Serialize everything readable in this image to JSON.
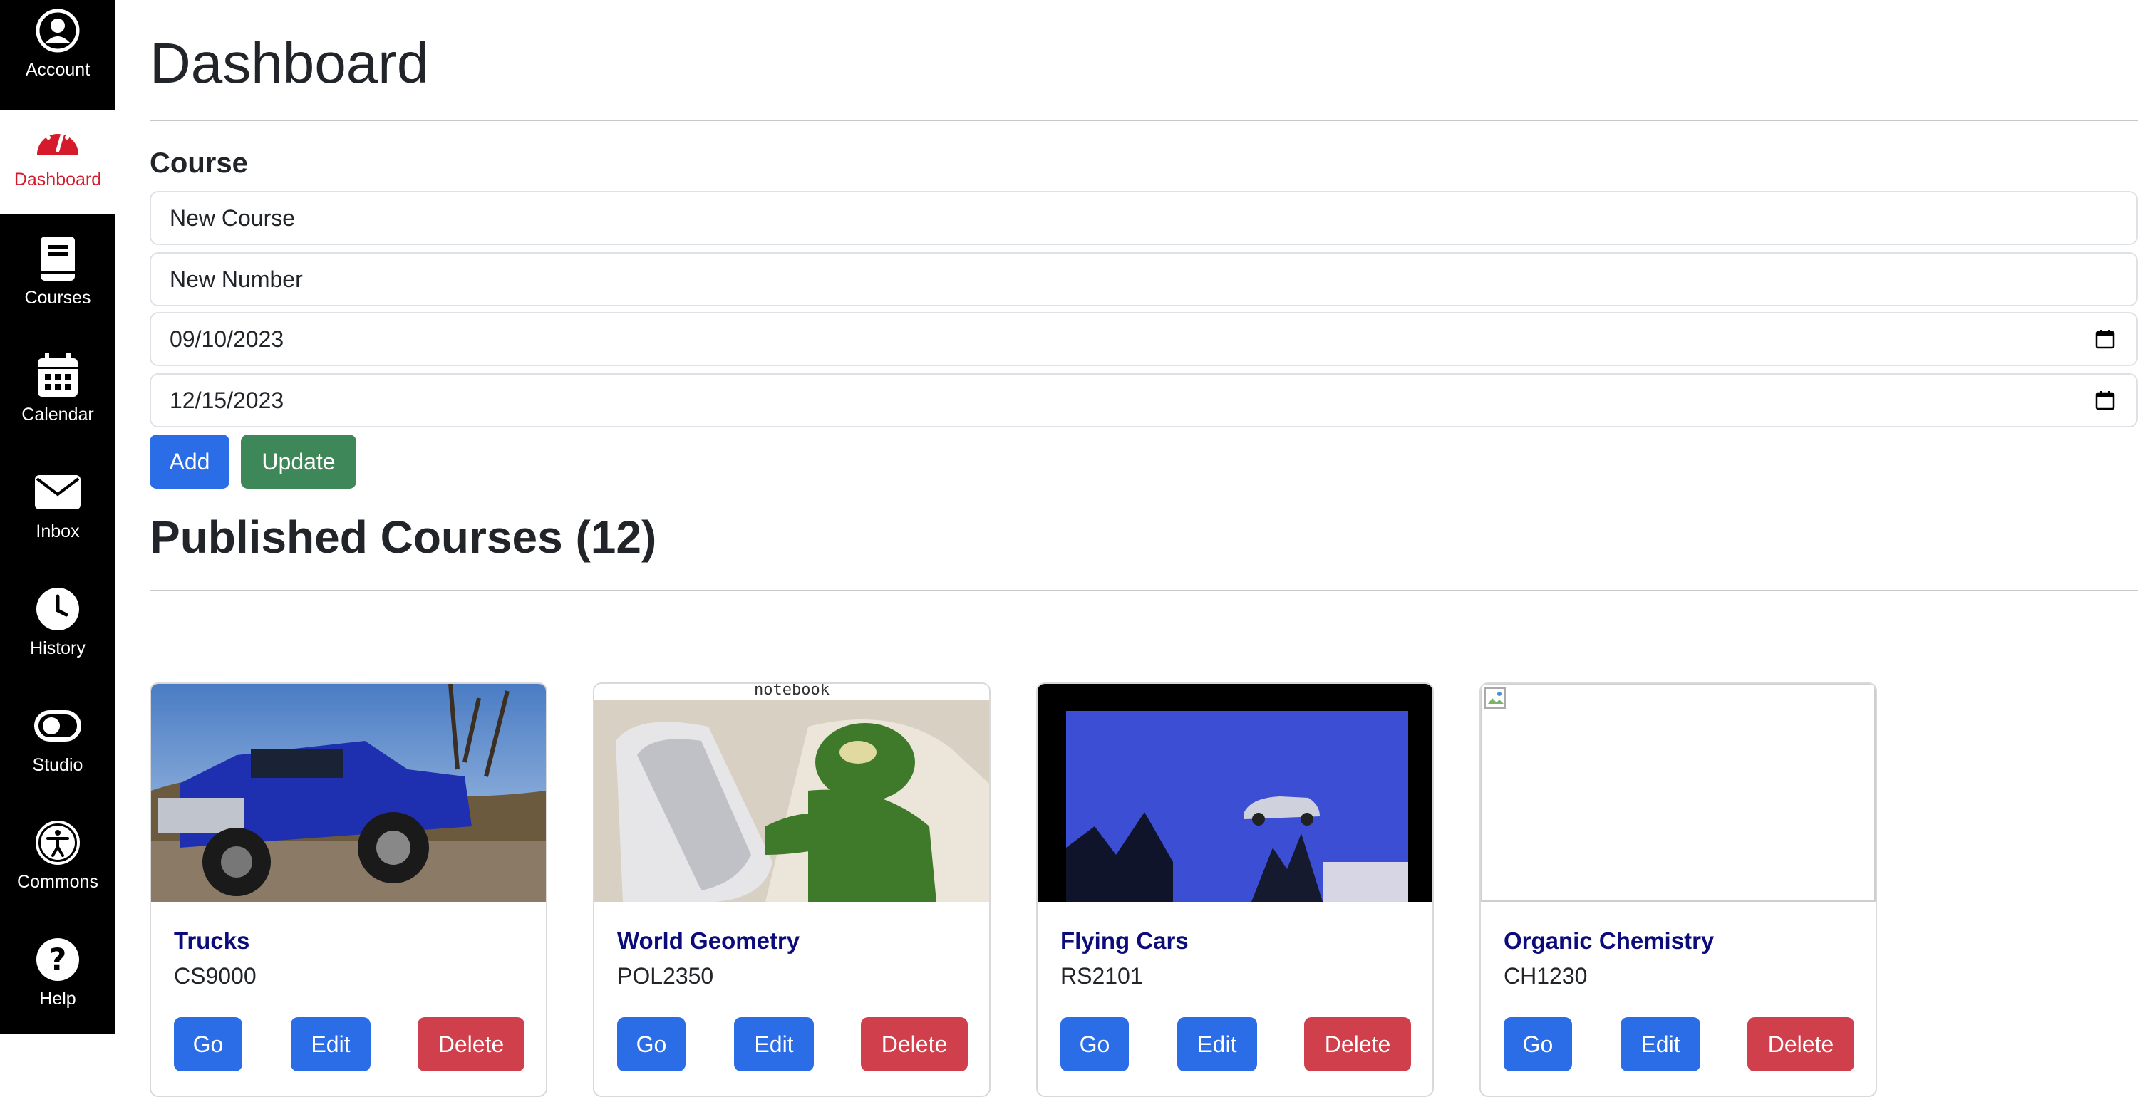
{
  "sidebar": {
    "items": [
      {
        "label": "Account",
        "icon": "account-icon"
      },
      {
        "label": "Dashboard",
        "icon": "dashboard-icon"
      },
      {
        "label": "Courses",
        "icon": "book-icon"
      },
      {
        "label": "Calendar",
        "icon": "calendar-icon"
      },
      {
        "label": "Inbox",
        "icon": "inbox-icon"
      },
      {
        "label": "History",
        "icon": "clock-icon"
      },
      {
        "label": "Studio",
        "icon": "studio-icon"
      },
      {
        "label": "Commons",
        "icon": "accessibility-icon"
      },
      {
        "label": "Help",
        "icon": "help-icon"
      }
    ],
    "active": "Dashboard",
    "active_color": "#d51a2c"
  },
  "page": {
    "title": "Dashboard",
    "section_label": "Course",
    "course_name": "New Course",
    "course_number": "New Number",
    "start_date": "09/10/2023",
    "end_date": "12/15/2023",
    "add_label": "Add",
    "update_label": "Update",
    "published_title": "Published Courses (12)"
  },
  "courses": [
    {
      "title": "Trucks",
      "number": "CS9000",
      "image": "blue-truck-photo",
      "go": "Go",
      "edit": "Edit",
      "delete": "Delete"
    },
    {
      "title": "World Geometry",
      "number": "POL2350",
      "image": "kermit-phone-photo",
      "caption": "notebook",
      "go": "Go",
      "edit": "Edit",
      "delete": "Delete"
    },
    {
      "title": "Flying Cars",
      "number": "RS2101",
      "image": "flying-car-photo",
      "go": "Go",
      "edit": "Edit",
      "delete": "Delete"
    },
    {
      "title": "Organic Chemistry",
      "number": "CH1230",
      "image": "broken-image",
      "go": "Go",
      "edit": "Edit",
      "delete": "Delete"
    }
  ],
  "colors": {
    "primary": "#2b6de6",
    "success": "#3e8758",
    "danger": "#d0404c",
    "course_title": "#0b0b7a"
  }
}
